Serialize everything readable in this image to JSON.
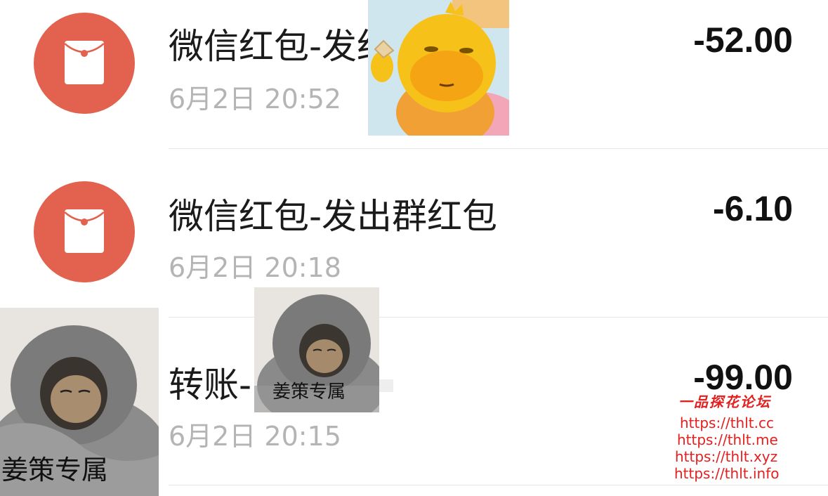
{
  "transactions": [
    {
      "title": "微信红包-发红",
      "time": "6月2日 20:52",
      "amount": "-52.00",
      "icon": "red-packet-icon"
    },
    {
      "title": "微信红包-发出群红包",
      "time": "6月2日 20:18",
      "amount": "-6.10",
      "icon": "red-packet-icon"
    },
    {
      "title": "转账-",
      "time": "6月2日 20:15",
      "amount": "-99.00",
      "icon": "transfer-icon"
    }
  ],
  "stickers": {
    "cat_caption": "姜策专属",
    "cat_small_caption": "姜策专属"
  },
  "watermark": {
    "title": "一品探花论坛",
    "urls": [
      "https://thlt.cc",
      "https://thlt.me",
      "https://thlt.xyz",
      "https://thlt.info"
    ]
  },
  "colors": {
    "red_packet": "#e3624f",
    "amount": "#111111",
    "time": "#b4b4b4",
    "watermark": "#e22020"
  }
}
